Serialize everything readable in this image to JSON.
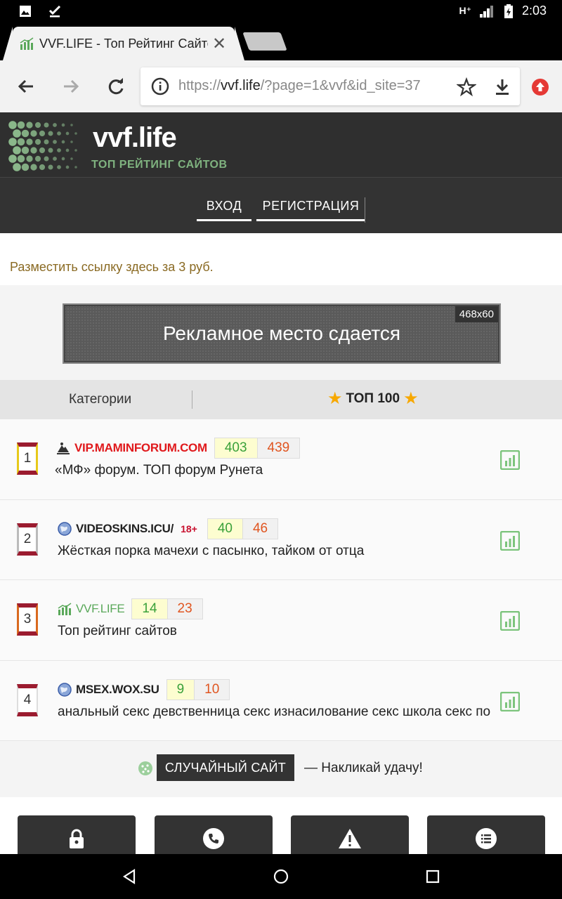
{
  "status_bar": {
    "network": "H⁺",
    "time": "2:03"
  },
  "browser": {
    "tab_title": "VVF.LIFE - Топ Рейтинг Сайтов",
    "url_scheme": "https://",
    "url_host": "vvf.life",
    "url_path": "/?page=1&vvf&id_site=37"
  },
  "site": {
    "name": "vvf.life",
    "tagline": "ТОП РЕЙТИНГ САЙТОВ",
    "nav": {
      "login": "ВХОД",
      "register": "РЕГИСТРАЦИЯ"
    },
    "ad_link": "Разместить ссылку здесь за 3 руб.",
    "banner_text": "Рекламное место сдается",
    "banner_size": "468x60",
    "tabs": {
      "categories": "Категории",
      "top": "ТОП 100"
    }
  },
  "rows": [
    {
      "rank": "1",
      "domain": "VIP.MAMINFORUM.COM",
      "domain_color": "#e0191c",
      "in": "403",
      "out": "439",
      "desc": "«МФ» форум. ТОП форум Рунета"
    },
    {
      "rank": "2",
      "domain": "VIDEOSKINS.ICU/",
      "domain_color": "#222222",
      "badge": "18+",
      "in": "40",
      "out": "46",
      "desc": "Жёсткая порка мачехи с пасынко, тайком от отца"
    },
    {
      "rank": "3",
      "domain": "VVF.LIFE",
      "domain_color": "#5aa85a",
      "in": "14",
      "out": "23",
      "desc": "Топ рейтинг сайтов"
    },
    {
      "rank": "4",
      "domain": "MSEX.WOX.SU",
      "domain_color": "#222222",
      "in": "9",
      "out": "10",
      "desc": "анальный секс девственница секс изнасилование секс школа секс по"
    }
  ],
  "random": {
    "button": "СЛУЧАЙНЫЙ САЙТ",
    "text": "— Накликай удачу!"
  },
  "bottom_buttons": [
    "lock-icon",
    "phone-icon",
    "warning-icon",
    "list-icon"
  ]
}
